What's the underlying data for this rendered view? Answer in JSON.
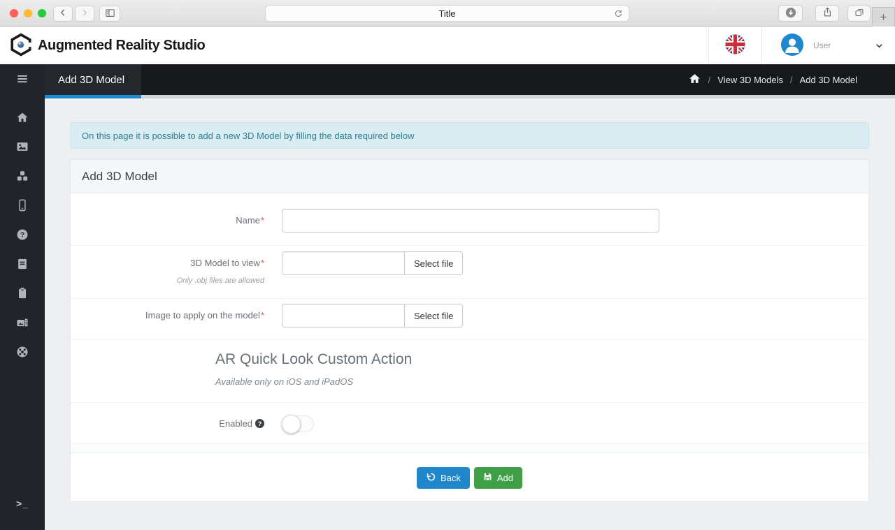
{
  "browser": {
    "page_title": "Title",
    "new_tab_label": "+",
    "window_controls": [
      "close",
      "minimize",
      "maximize"
    ],
    "toolbar_icons": [
      "back-chevron",
      "forward-chevron",
      "sidebar-toggle",
      "reload",
      "download",
      "share",
      "tabs-overview",
      "new-tab"
    ]
  },
  "header": {
    "app_name": "Augmented Reality Studio",
    "user_label": "User",
    "icons": [
      "hexagon-logo",
      "uk-flag",
      "user-avatar",
      "chevron-down"
    ]
  },
  "navbar": {
    "active_tab": "Add 3D Model",
    "breadcrumb": {
      "separator": "/",
      "items": [
        "View 3D Models",
        "Add 3D Model"
      ]
    }
  },
  "sidebar": {
    "icons": [
      "menu",
      "home",
      "images",
      "cubes",
      "mobile",
      "help",
      "book",
      "clipboard",
      "media",
      "support",
      "terminal"
    ],
    "terminal_glyph": ">_"
  },
  "alert": {
    "text": "On this page it is possible to add a new 3D Model by filling the data required below"
  },
  "form": {
    "card_title": "Add 3D Model",
    "required_marker": "*",
    "name_label": "Name",
    "name_value": "",
    "model_label": "3D Model to view",
    "model_help": "Only .obj files are allowed",
    "model_value": "",
    "image_label": "Image to apply on the model",
    "image_value": "",
    "select_file_label": "Select file",
    "section_title": "AR Quick Look Custom Action",
    "section_subtitle": "Available only on iOS and iPadOS",
    "enabled_label": "Enabled",
    "enabled_state": "off"
  },
  "actions": {
    "back_label": "Back",
    "add_label": "Add"
  },
  "colors": {
    "primary_blue": "#1f87ca",
    "success_green": "#3f9f46",
    "tab_underline": "#1d8bd1",
    "alert_bg": "#d9edf3",
    "alert_text": "#2e7d93",
    "required_red": "#d9534f",
    "avatar_blue": "#1e88cf",
    "navbar_bg": "#17191d",
    "sidebar_bg": "#212529"
  }
}
